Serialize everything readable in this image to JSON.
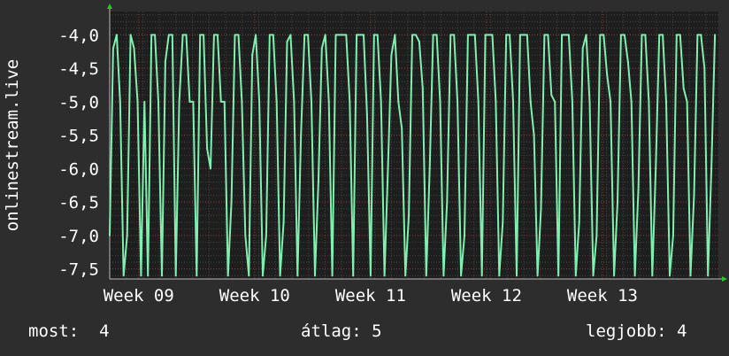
{
  "chart_data": {
    "type": "line",
    "title": "",
    "ylabel": "onlinestream.live",
    "xlabel": "",
    "ylim": [
      -7.65,
      -3.65
    ],
    "yticks": [
      -4.0,
      -4.5,
      -5.0,
      -5.5,
      -6.0,
      -6.5,
      -7.0,
      -7.5
    ],
    "ytick_labels": [
      "-4,0",
      "-4,5",
      "-5,0",
      "-5,5",
      "-6,0",
      "-6,5",
      "-7,0",
      "-7,5"
    ],
    "xlim": [
      0,
      5.25
    ],
    "xticks": [
      0.25,
      1.25,
      2.25,
      3.25,
      4.25
    ],
    "xtick_labels": [
      "Week 09",
      "Week 10",
      "Week 11",
      "Week 12",
      "Week 13"
    ],
    "grid": true,
    "colors": {
      "background": "#2d2d2d",
      "plot_background": "#1e1e1e",
      "grid_minor": "#444444",
      "grid_major": "#8a3a3a",
      "line": "#7ff0b0",
      "axis_arrow": "#22cc22",
      "text": "#ffffff"
    },
    "series": [
      {
        "name": "",
        "x": [
          0.0,
          0.03,
          0.06,
          0.09,
          0.12,
          0.15,
          0.18,
          0.21,
          0.24,
          0.27,
          0.3,
          0.33,
          0.36,
          0.39,
          0.42,
          0.45,
          0.48,
          0.51,
          0.54,
          0.57,
          0.6,
          0.63,
          0.66,
          0.69,
          0.72,
          0.75,
          0.78,
          0.81,
          0.84,
          0.87,
          0.9,
          0.93,
          0.96,
          0.99,
          1.02,
          1.05,
          1.08,
          1.11,
          1.14,
          1.17,
          1.2,
          1.23,
          1.26,
          1.29,
          1.32,
          1.35,
          1.38,
          1.41,
          1.44,
          1.47,
          1.5,
          1.53,
          1.56,
          1.59,
          1.62,
          1.65,
          1.68,
          1.71,
          1.74,
          1.77,
          1.8,
          1.83,
          1.86,
          1.89,
          1.92,
          1.95,
          1.98,
          2.01,
          2.04,
          2.07,
          2.1,
          2.13,
          2.16,
          2.19,
          2.22,
          2.25,
          2.28,
          2.31,
          2.34,
          2.37,
          2.4,
          2.43,
          2.46,
          2.49,
          2.52,
          2.55,
          2.58,
          2.61,
          2.64,
          2.67,
          2.7,
          2.73,
          2.76,
          2.79,
          2.82,
          2.85,
          2.88,
          2.91,
          2.94,
          2.97,
          3.0,
          3.03,
          3.06,
          3.09,
          3.12,
          3.15,
          3.18,
          3.21,
          3.24,
          3.27,
          3.3,
          3.33,
          3.36,
          3.39,
          3.42,
          3.45,
          3.48,
          3.51,
          3.54,
          3.57,
          3.6,
          3.63,
          3.66,
          3.69,
          3.72,
          3.75,
          3.78,
          3.81,
          3.84,
          3.87,
          3.9,
          3.93,
          3.96,
          3.99,
          4.02,
          4.05,
          4.08,
          4.11,
          4.14,
          4.17,
          4.2,
          4.23,
          4.26,
          4.29,
          4.32,
          4.35,
          4.38,
          4.41,
          4.44,
          4.47,
          4.5,
          4.53,
          4.56,
          4.59,
          4.62,
          4.65,
          4.68,
          4.71,
          4.74,
          4.77,
          4.8,
          4.83,
          4.86,
          4.89,
          4.92,
          4.95,
          4.98,
          5.01,
          5.04,
          5.07,
          5.1,
          5.13,
          5.16,
          5.19,
          5.22
        ],
        "values": [
          -7.0,
          -4.2,
          -4.0,
          -5.0,
          -7.6,
          -7.0,
          -4.0,
          -4.2,
          -5.0,
          -7.6,
          -5.0,
          -7.6,
          -4.0,
          -4.0,
          -5.0,
          -7.6,
          -4.4,
          -4.0,
          -4.0,
          -7.6,
          -5.0,
          -4.0,
          -4.0,
          -5.0,
          -5.0,
          -7.6,
          -4.0,
          -4.0,
          -5.7,
          -6.0,
          -4.0,
          -4.0,
          -5.0,
          -5.0,
          -7.6,
          -6.5,
          -4.0,
          -4.0,
          -5.0,
          -7.0,
          -7.6,
          -4.3,
          -4.0,
          -5.0,
          -7.6,
          -7.0,
          -4.0,
          -4.0,
          -5.0,
          -7.6,
          -6.8,
          -4.1,
          -4.0,
          -5.0,
          -7.6,
          -5.5,
          -4.0,
          -4.0,
          -5.0,
          -7.6,
          -6.2,
          -4.2,
          -4.0,
          -5.0,
          -7.6,
          -4.0,
          -4.0,
          -4.0,
          -4.0,
          -5.0,
          -7.6,
          -4.0,
          -4.0,
          -4.0,
          -5.2,
          -7.6,
          -4.0,
          -4.0,
          -5.0,
          -7.6,
          -6.0,
          -4.3,
          -4.0,
          -5.0,
          -5.4,
          -7.6,
          -6.7,
          -4.0,
          -4.0,
          -4.1,
          -4.8,
          -7.6,
          -6.0,
          -4.0,
          -4.0,
          -5.0,
          -7.6,
          -6.5,
          -4.0,
          -4.0,
          -5.0,
          -7.6,
          -7.0,
          -4.0,
          -4.0,
          -4.0,
          -5.0,
          -7.6,
          -4.0,
          -4.0,
          -4.0,
          -5.0,
          -7.6,
          -6.8,
          -4.0,
          -4.0,
          -5.0,
          -7.6,
          -4.0,
          -4.0,
          -4.0,
          -5.0,
          -5.5,
          -7.6,
          -6.6,
          -4.0,
          -4.0,
          -4.9,
          -5.0,
          -7.6,
          -4.0,
          -4.0,
          -4.0,
          -5.0,
          -7.6,
          -6.8,
          -4.2,
          -4.0,
          -5.0,
          -7.6,
          -7.0,
          -4.0,
          -4.0,
          -4.6,
          -5.0,
          -7.6,
          -6.5,
          -4.0,
          -4.0,
          -4.4,
          -5.0,
          -7.6,
          -6.3,
          -4.0,
          -4.0,
          -5.0,
          -7.6,
          -6.0,
          -4.0,
          -4.0,
          -5.0,
          -7.6,
          -7.0,
          -4.0,
          -4.0,
          -4.8,
          -5.0,
          -7.6,
          -6.4,
          -4.0,
          -4.0,
          -4.5,
          -7.6,
          -6.0,
          -4.0
        ]
      }
    ]
  },
  "legend": {
    "now": "most:  4",
    "average": "átlag: 5",
    "best": "legjobb: 4"
  }
}
